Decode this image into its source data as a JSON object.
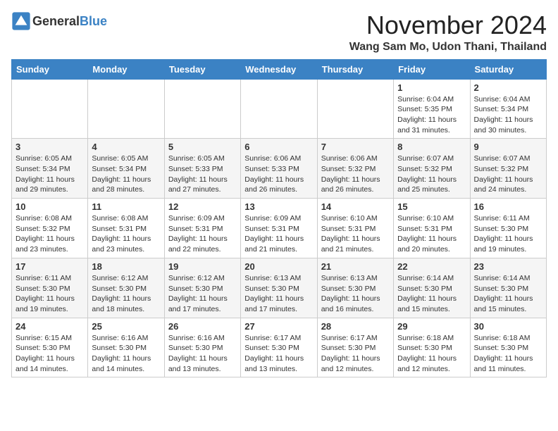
{
  "header": {
    "logo_general": "General",
    "logo_blue": "Blue",
    "month_title": "November 2024",
    "location": "Wang Sam Mo, Udon Thani, Thailand"
  },
  "days_of_week": [
    "Sunday",
    "Monday",
    "Tuesday",
    "Wednesday",
    "Thursday",
    "Friday",
    "Saturday"
  ],
  "weeks": [
    [
      {
        "day": "",
        "info": ""
      },
      {
        "day": "",
        "info": ""
      },
      {
        "day": "",
        "info": ""
      },
      {
        "day": "",
        "info": ""
      },
      {
        "day": "",
        "info": ""
      },
      {
        "day": "1",
        "info": "Sunrise: 6:04 AM\nSunset: 5:35 PM\nDaylight: 11 hours and 31 minutes."
      },
      {
        "day": "2",
        "info": "Sunrise: 6:04 AM\nSunset: 5:34 PM\nDaylight: 11 hours and 30 minutes."
      }
    ],
    [
      {
        "day": "3",
        "info": "Sunrise: 6:05 AM\nSunset: 5:34 PM\nDaylight: 11 hours and 29 minutes."
      },
      {
        "day": "4",
        "info": "Sunrise: 6:05 AM\nSunset: 5:34 PM\nDaylight: 11 hours and 28 minutes."
      },
      {
        "day": "5",
        "info": "Sunrise: 6:05 AM\nSunset: 5:33 PM\nDaylight: 11 hours and 27 minutes."
      },
      {
        "day": "6",
        "info": "Sunrise: 6:06 AM\nSunset: 5:33 PM\nDaylight: 11 hours and 26 minutes."
      },
      {
        "day": "7",
        "info": "Sunrise: 6:06 AM\nSunset: 5:32 PM\nDaylight: 11 hours and 26 minutes."
      },
      {
        "day": "8",
        "info": "Sunrise: 6:07 AM\nSunset: 5:32 PM\nDaylight: 11 hours and 25 minutes."
      },
      {
        "day": "9",
        "info": "Sunrise: 6:07 AM\nSunset: 5:32 PM\nDaylight: 11 hours and 24 minutes."
      }
    ],
    [
      {
        "day": "10",
        "info": "Sunrise: 6:08 AM\nSunset: 5:32 PM\nDaylight: 11 hours and 23 minutes."
      },
      {
        "day": "11",
        "info": "Sunrise: 6:08 AM\nSunset: 5:31 PM\nDaylight: 11 hours and 23 minutes."
      },
      {
        "day": "12",
        "info": "Sunrise: 6:09 AM\nSunset: 5:31 PM\nDaylight: 11 hours and 22 minutes."
      },
      {
        "day": "13",
        "info": "Sunrise: 6:09 AM\nSunset: 5:31 PM\nDaylight: 11 hours and 21 minutes."
      },
      {
        "day": "14",
        "info": "Sunrise: 6:10 AM\nSunset: 5:31 PM\nDaylight: 11 hours and 21 minutes."
      },
      {
        "day": "15",
        "info": "Sunrise: 6:10 AM\nSunset: 5:31 PM\nDaylight: 11 hours and 20 minutes."
      },
      {
        "day": "16",
        "info": "Sunrise: 6:11 AM\nSunset: 5:30 PM\nDaylight: 11 hours and 19 minutes."
      }
    ],
    [
      {
        "day": "17",
        "info": "Sunrise: 6:11 AM\nSunset: 5:30 PM\nDaylight: 11 hours and 19 minutes."
      },
      {
        "day": "18",
        "info": "Sunrise: 6:12 AM\nSunset: 5:30 PM\nDaylight: 11 hours and 18 minutes."
      },
      {
        "day": "19",
        "info": "Sunrise: 6:12 AM\nSunset: 5:30 PM\nDaylight: 11 hours and 17 minutes."
      },
      {
        "day": "20",
        "info": "Sunrise: 6:13 AM\nSunset: 5:30 PM\nDaylight: 11 hours and 17 minutes."
      },
      {
        "day": "21",
        "info": "Sunrise: 6:13 AM\nSunset: 5:30 PM\nDaylight: 11 hours and 16 minutes."
      },
      {
        "day": "22",
        "info": "Sunrise: 6:14 AM\nSunset: 5:30 PM\nDaylight: 11 hours and 15 minutes."
      },
      {
        "day": "23",
        "info": "Sunrise: 6:14 AM\nSunset: 5:30 PM\nDaylight: 11 hours and 15 minutes."
      }
    ],
    [
      {
        "day": "24",
        "info": "Sunrise: 6:15 AM\nSunset: 5:30 PM\nDaylight: 11 hours and 14 minutes."
      },
      {
        "day": "25",
        "info": "Sunrise: 6:16 AM\nSunset: 5:30 PM\nDaylight: 11 hours and 14 minutes."
      },
      {
        "day": "26",
        "info": "Sunrise: 6:16 AM\nSunset: 5:30 PM\nDaylight: 11 hours and 13 minutes."
      },
      {
        "day": "27",
        "info": "Sunrise: 6:17 AM\nSunset: 5:30 PM\nDaylight: 11 hours and 13 minutes."
      },
      {
        "day": "28",
        "info": "Sunrise: 6:17 AM\nSunset: 5:30 PM\nDaylight: 11 hours and 12 minutes."
      },
      {
        "day": "29",
        "info": "Sunrise: 6:18 AM\nSunset: 5:30 PM\nDaylight: 11 hours and 12 minutes."
      },
      {
        "day": "30",
        "info": "Sunrise: 6:18 AM\nSunset: 5:30 PM\nDaylight: 11 hours and 11 minutes."
      }
    ]
  ]
}
